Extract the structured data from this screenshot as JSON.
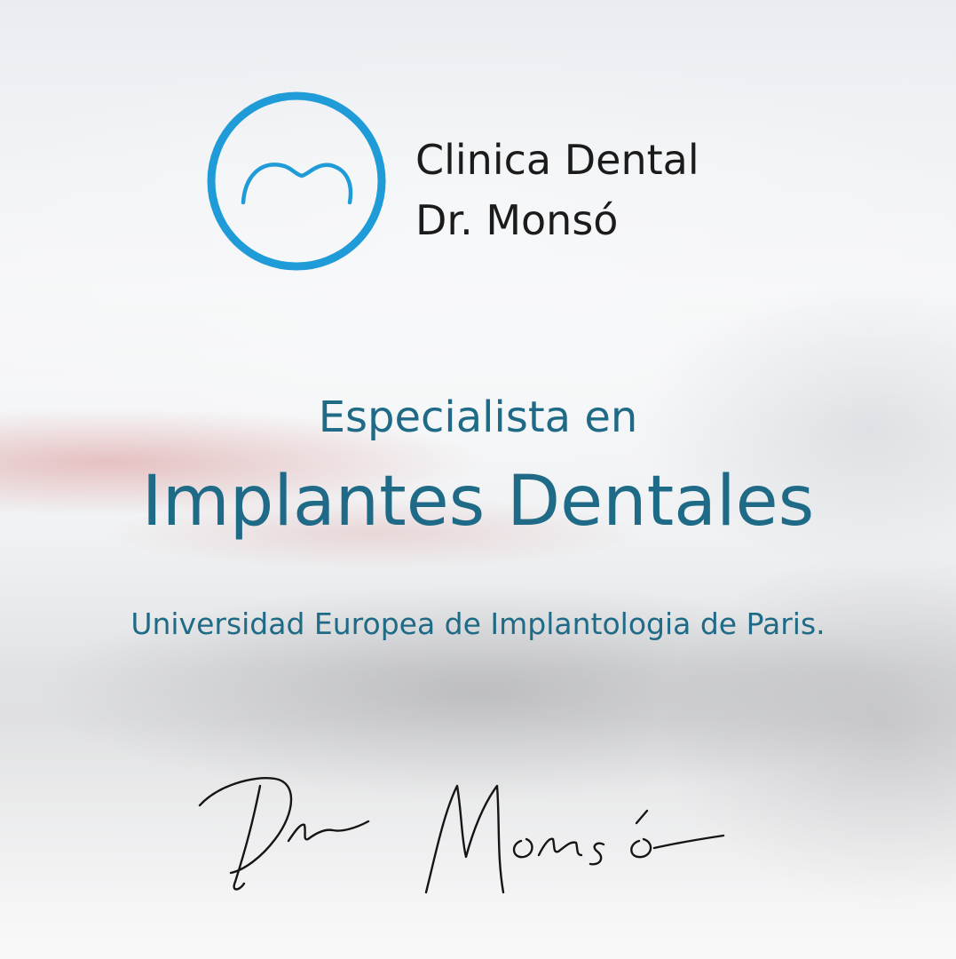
{
  "brand": {
    "name_line1": "Clinica Dental",
    "name_line2": "Dr. Monsó",
    "logo_ring_color": "#1f9bd7",
    "logo_icon": "tooth-arc-icon"
  },
  "main": {
    "subtitle": "Especialista en",
    "headline": "Implantes Dentales",
    "affiliation": "Universidad Europea de Implantologia de Paris.",
    "text_color": "#1f6a86"
  },
  "signature": {
    "text": "Dr Monsó",
    "icon": "handwritten-signature"
  }
}
